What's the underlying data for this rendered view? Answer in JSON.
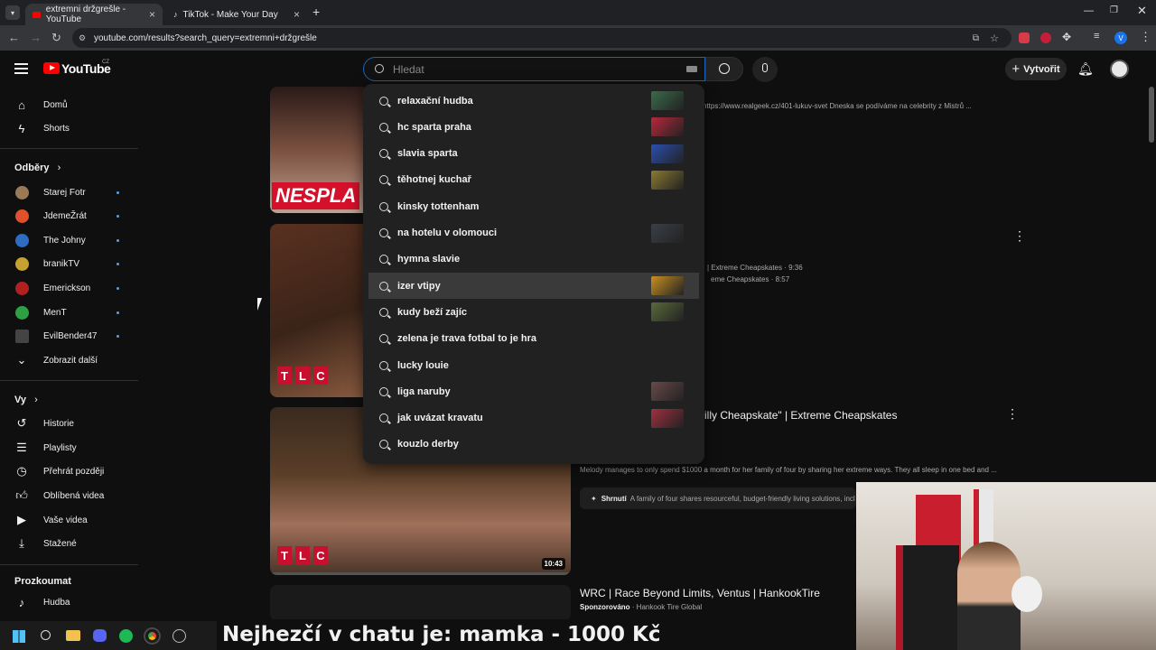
{
  "browser": {
    "tabs": [
      {
        "title": "extremni držgrešle - YouTube"
      },
      {
        "title": "TikTok - Make Your Day"
      }
    ],
    "url": "youtube.com/results?search_query=extremni+držgrešle"
  },
  "header": {
    "logo": "YouTube",
    "region": "CZ",
    "search_placeholder": "Hledat",
    "create_label": "Vytvořit"
  },
  "sidebar": {
    "main": [
      {
        "label": "Domů",
        "icon": "home-icon"
      },
      {
        "label": "Shorts",
        "icon": "shorts-icon"
      }
    ],
    "subs_title": "Odběry",
    "subs": [
      {
        "label": "Starej Fotr",
        "color": "#9a7a55"
      },
      {
        "label": "JdemeŽrát",
        "color": "#e0502a"
      },
      {
        "label": "The Johny",
        "color": "#2d6cc0"
      },
      {
        "label": "branikTV",
        "color": "#c4a130"
      },
      {
        "label": "Emerickson",
        "color": "#b02020"
      },
      {
        "label": "MenT",
        "color": "#2ea043"
      },
      {
        "label": "EvilBender47",
        "color": "#444444"
      }
    ],
    "show_more": "Zobrazit další",
    "you_title": "Vy",
    "you": [
      {
        "label": "Historie",
        "icon": "history-icon"
      },
      {
        "label": "Playlisty",
        "icon": "playlist-icon"
      },
      {
        "label": "Přehrát později",
        "icon": "watch-later-icon"
      },
      {
        "label": "Oblíbená videa",
        "icon": "like-icon"
      },
      {
        "label": "Vaše videa",
        "icon": "your-videos-icon"
      },
      {
        "label": "Stažené",
        "icon": "download-icon"
      }
    ],
    "explore_title": "Prozkoumat",
    "explore": [
      {
        "label": "Hudba",
        "icon": "music-icon"
      }
    ]
  },
  "results": {
    "r1_link": "https://www.realgeek.cz/401-lukuv-svet Dneska se podíváme na celebrity z Mistrů ...",
    "r1_thumb_text": "NESPLA",
    "r2_line1": "| Extreme Cheapskates · 9:36",
    "r2_line2": "eme Cheapskates · 8:57",
    "r2_tlc": [
      "T",
      "L",
      "C"
    ],
    "r3_title": "illy Cheapskate\" | Extreme Cheapskates",
    "r3_desc": "Melody manages to only spend $1000 a month for her family of four by sharing her extreme ways. They all sleep in one bed and ...",
    "r3_summary_label": "Shrnutí",
    "r3_summary": "A family of four shares resourceful, budget-friendly living solutions, incl",
    "r3_duration": "10:43",
    "r3_tlc": [
      "T",
      "L",
      "C"
    ],
    "ad_title": "WRC | Race Beyond Limits, Ventus | HankookTire",
    "ad_sponsored": "Sponzorováno",
    "ad_channel": "· Hankook Tire Global"
  },
  "suggestions": [
    {
      "text": "relaxační hudba",
      "thumb": "#3a6b4a"
    },
    {
      "text": "hc sparta praha",
      "thumb": "#b8283a"
    },
    {
      "text": "slavia sparta",
      "thumb": "#2a4fb0"
    },
    {
      "text": "těhotnej kuchař",
      "thumb": "#8a7a30"
    },
    {
      "text": "kinsky tottenham",
      "thumb": ""
    },
    {
      "text": "na hotelu v olomouci",
      "thumb": "#3a3f48"
    },
    {
      "text": "hymna slavie",
      "thumb": ""
    },
    {
      "text": "izer vtipy",
      "thumb": "#c89020"
    },
    {
      "text": "kudy beží zajíc",
      "thumb": "#5a6a3a"
    },
    {
      "text": "zelena je trava fotbal to je hra",
      "thumb": ""
    },
    {
      "text": "lucky louie",
      "thumb": ""
    },
    {
      "text": "liga naruby",
      "thumb": "#6a4a4a"
    },
    {
      "text": "jak uvázat kravatu",
      "thumb": "#a03040"
    },
    {
      "text": "kouzlo derby",
      "thumb": ""
    }
  ],
  "stream_caption": "Nejhezčí v chatu je: mamka - 1000 Kč"
}
